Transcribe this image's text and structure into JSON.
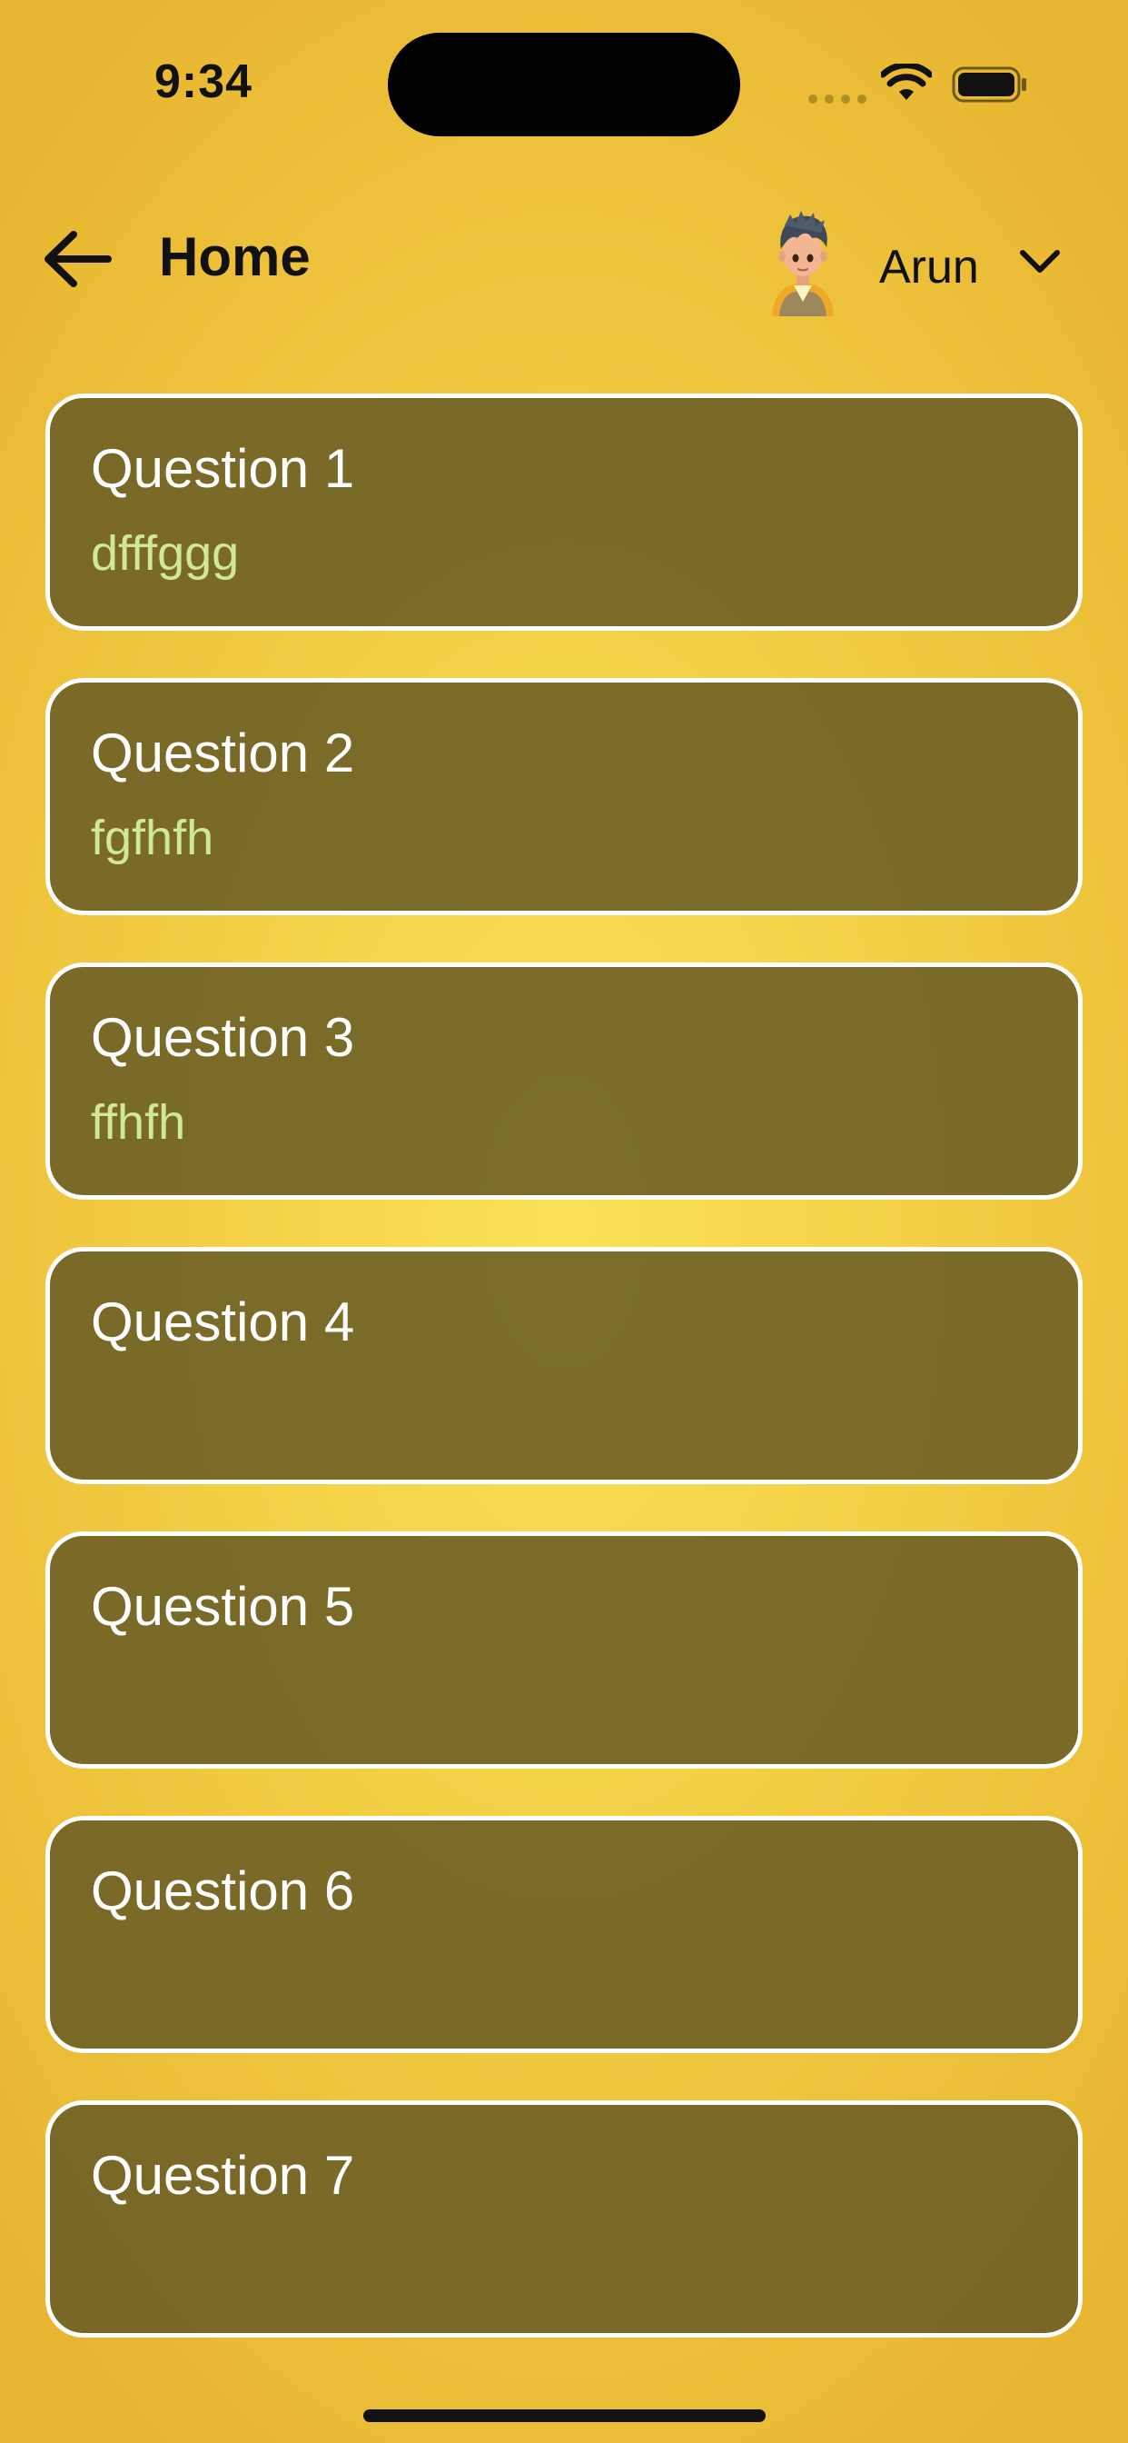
{
  "status_bar": {
    "time": "9:34"
  },
  "header": {
    "title": "Home",
    "user_name": "Arun"
  },
  "questions": [
    {
      "title": "Question 1",
      "answer": "dfffggg"
    },
    {
      "title": "Question 2",
      "answer": "fgfhfh"
    },
    {
      "title": "Question 3",
      "answer": "ffhfh"
    },
    {
      "title": "Question 4",
      "answer": ""
    },
    {
      "title": "Question 5",
      "answer": ""
    },
    {
      "title": "Question 6",
      "answer": ""
    },
    {
      "title": "Question 7",
      "answer": ""
    }
  ],
  "icons": {
    "back": "arrow-left-icon",
    "user_menu": "chevron-down-icon",
    "wifi": "wifi-icon",
    "battery": "battery-icon"
  },
  "colors": {
    "background": "#f3cf44",
    "card_fill": "#665a24",
    "card_border": "#ffffff",
    "answer_text": "#cfe89a"
  }
}
